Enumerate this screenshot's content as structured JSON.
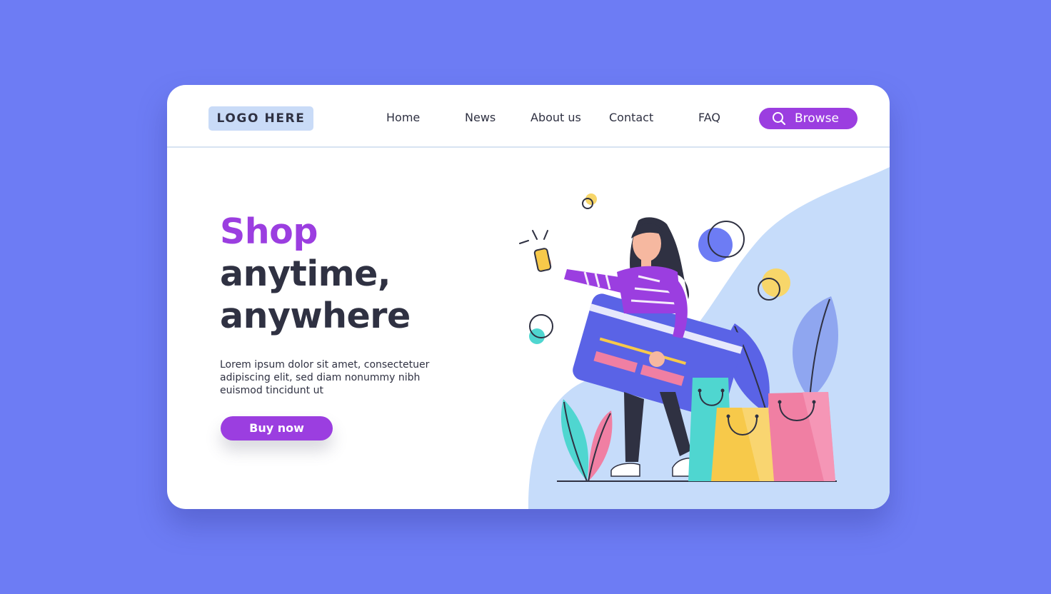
{
  "colors": {
    "background": "#6d7cf4",
    "accent": "#9b3ee0",
    "text_dark": "#2f3142",
    "logo_bg": "#c9dbf7",
    "blob": "#c6dcfa"
  },
  "header": {
    "logo": "LOGO HERE",
    "nav": [
      "Home",
      "News",
      "About us",
      "Contact",
      "FAQ"
    ],
    "browse_label": "Browse",
    "browse_icon": "search-icon"
  },
  "hero": {
    "headline_line1": "Shop",
    "headline_line2": "anytime,",
    "headline_line3": "anywhere",
    "description": "Lorem ipsum dolor sit amet, consectetuer adipiscing elit, sed diam nonummy nibh euismod tincidunt ut",
    "cta_label": "Buy now"
  },
  "illustration": {
    "subject": "woman-holding-credit-card-and-phone",
    "items": [
      "credit-card",
      "phone",
      "shopping-bags",
      "leaves",
      "circles"
    ]
  }
}
